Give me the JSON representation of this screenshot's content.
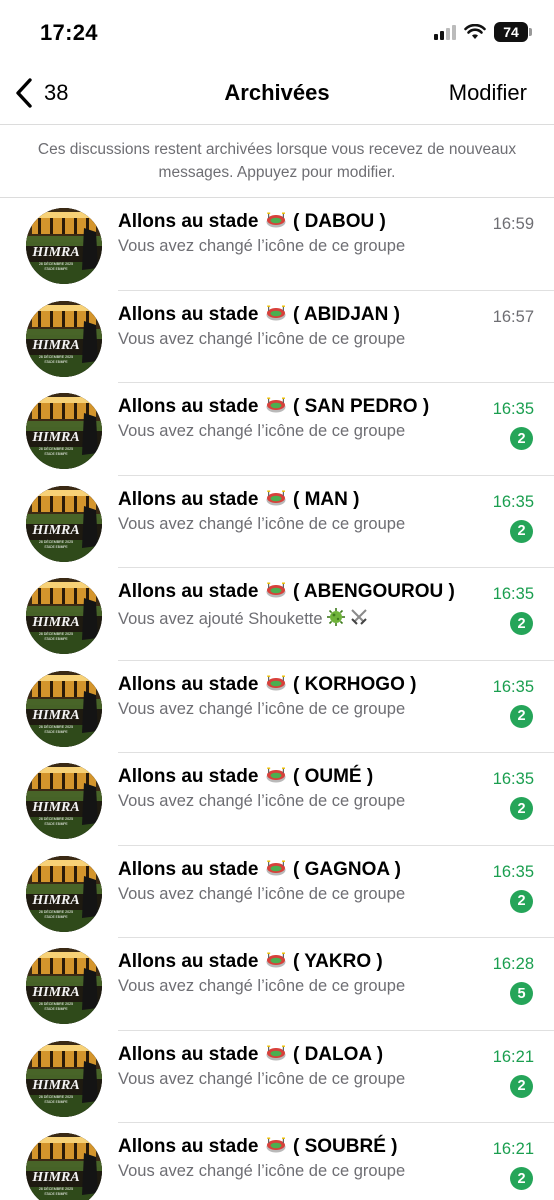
{
  "status_bar": {
    "time": "17:24",
    "battery": "74"
  },
  "nav": {
    "back_count": "38",
    "title": "Archivées",
    "edit_label": "Modifier"
  },
  "info": {
    "text": "Ces discussions restent archivées lorsque vous recevez de nouveaux messages. Appuyez pour modifier."
  },
  "chats": [
    {
      "prefix": "Allons au stade",
      "suffix": "( DABOU )",
      "preview": "Vous avez changé l’icône de ce groupe",
      "time": "16:59",
      "unread": ""
    },
    {
      "prefix": "Allons au stade",
      "suffix": "( ABIDJAN )",
      "preview": "Vous avez changé l’icône de ce groupe",
      "time": "16:57",
      "unread": ""
    },
    {
      "prefix": "Allons au stade",
      "suffix": "( SAN PEDRO )",
      "preview": "Vous avez changé l’icône de ce groupe",
      "time": "16:35",
      "unread": "2"
    },
    {
      "prefix": "Allons au stade",
      "suffix": "( MAN )",
      "preview": "Vous avez changé l’icône de ce groupe",
      "time": "16:35",
      "unread": "2"
    },
    {
      "prefix": "Allons au stade",
      "suffix": "( ABENGOUROU )",
      "preview": "Vous avez ajouté Shoukette",
      "time": "16:35",
      "unread": "2"
    },
    {
      "prefix": "Allons au stade",
      "suffix": "( KORHOGO )",
      "preview": "Vous avez changé l’icône de ce groupe",
      "time": "16:35",
      "unread": "2"
    },
    {
      "prefix": "Allons au stade",
      "suffix": "( OUMÉ )",
      "preview": "Vous avez changé l’icône de ce groupe",
      "time": "16:35",
      "unread": "2"
    },
    {
      "prefix": "Allons au stade",
      "suffix": "( GAGNOA )",
      "preview": "Vous avez changé l’icône de ce groupe",
      "time": "16:35",
      "unread": "2"
    },
    {
      "prefix": "Allons au stade",
      "suffix": "( YAKRO )",
      "preview": "Vous avez changé l’icône de ce groupe",
      "time": "16:28",
      "unread": "5"
    },
    {
      "prefix": "Allons au stade",
      "suffix": "( DALOA )",
      "preview": "Vous avez changé l’icône de ce groupe",
      "time": "16:21",
      "unread": "2"
    },
    {
      "prefix": "Allons au stade",
      "suffix": "( SOUBRÉ )",
      "preview": "Vous avez changé l’icône de ce groupe",
      "time": "16:21",
      "unread": "2"
    }
  ],
  "avatar_text": {
    "logo": "HIMRA",
    "date": "28 DÉCEMBRE 2025",
    "venue": "STADE EBIMPE"
  },
  "colors": {
    "unread_green": "#25a559",
    "time_green": "#1a9e4f",
    "secondary_text": "#6e6e73"
  },
  "icons": {
    "stadium": "stadium-emoji-icon",
    "virus": "virus-emoji-icon",
    "swords": "crossed-swords-emoji-icon"
  }
}
